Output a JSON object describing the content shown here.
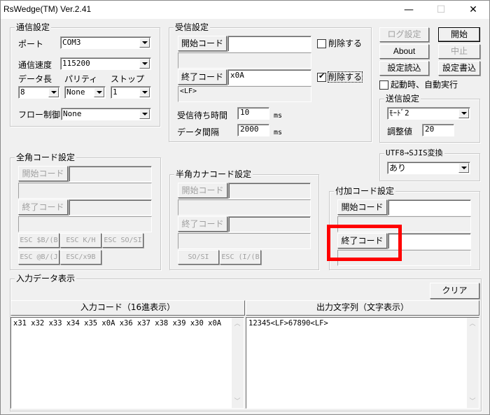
{
  "window": {
    "title": "RsWedge(TM) Ver.2.41",
    "controls": {
      "minimize": "—",
      "maximize": "☐",
      "close": "✕"
    }
  },
  "comm_settings": {
    "label": "通信設定",
    "port_label": "ポート",
    "port_value": "COM3",
    "baud_label": "通信速度",
    "baud_value": "115200",
    "databits_label": "データ長",
    "databits_value": "8",
    "parity_label": "パリティ",
    "parity_value": "None",
    "stopbits_label": "ストップ",
    "stopbits_value": "1",
    "flow_label": "フロー制御",
    "flow_value": "None"
  },
  "receive_settings": {
    "label": "受信設定",
    "start_code_button": "開始コード",
    "start_code_value": "",
    "start_code_info": "",
    "start_delete_label": "削除する",
    "start_delete_checked": false,
    "end_code_button": "終了コード",
    "end_code_value": "x0A",
    "end_code_info": "<LF>",
    "end_delete_label": "削除する",
    "end_delete_checked": true,
    "wait_time_label": "受信待ち時間",
    "wait_time_value": "10",
    "wait_time_unit": "ms",
    "interval_label": "データ間隔",
    "interval_value": "2000",
    "interval_unit": "ms"
  },
  "buttons": {
    "log_settings": "ログ設定",
    "start": "開始",
    "about": "About",
    "stop": "中止",
    "load_settings": "設定読込",
    "save_settings": "設定書込"
  },
  "autorun": {
    "label": "起動時、自動実行",
    "checked": false
  },
  "send_settings": {
    "label": "送信設定",
    "mode_value": "ﾓｰﾄﾞ2",
    "adjust_label": "調整値",
    "adjust_value": "20"
  },
  "utf8_sjis": {
    "label": "UTF8→SJIS変換",
    "value": "あり"
  },
  "fullwidth_code": {
    "label": "全角コード設定",
    "start_code_button": "開始コード",
    "end_code_button": "終了コード",
    "esc_buttons": [
      "ESC $B/(B",
      "ESC K/H",
      "ESC SO/SI",
      "ESC @B/(J",
      "ESC/x9B"
    ]
  },
  "halfwidth_kana": {
    "label": "半角カナコード設定",
    "start_code_button": "開始コード",
    "end_code_button": "終了コード",
    "esc_buttons": [
      "SO/SI",
      "ESC (I/(B"
    ]
  },
  "append_code": {
    "label": "付加コード設定",
    "start_code_button": "開始コード",
    "start_code_value": "",
    "end_code_button": "終了コード",
    "end_code_value": ""
  },
  "input_display": {
    "label": "入力データ表示",
    "clear_button": "クリア",
    "input_header": "入力コード（16進表示）",
    "output_header": "出力文字列（文字表示）",
    "input_content": "x31 x32 x33 x34 x35 x0A x36 x37 x38 x39 x30 x0A",
    "output_content": "12345<LF>67890<LF>"
  },
  "highlight_color": "#ff0000"
}
